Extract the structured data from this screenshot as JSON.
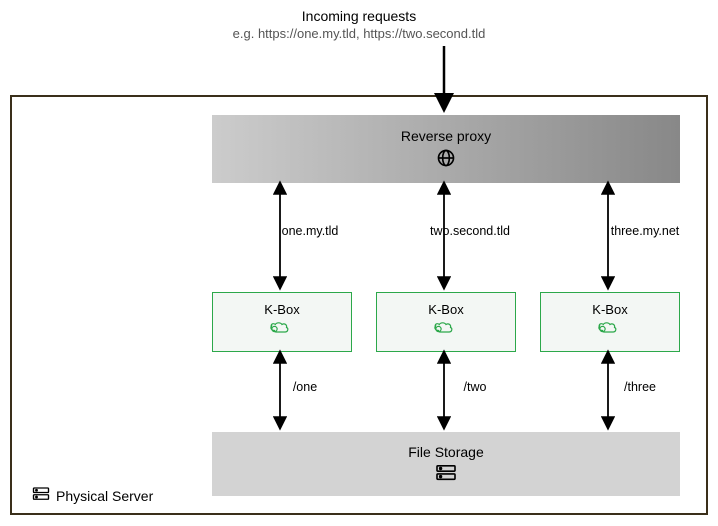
{
  "incoming": {
    "title": "Incoming requests",
    "subtitle": "e.g. https://one.my.tld, https://two.second.tld"
  },
  "server": {
    "label": "Physical Server"
  },
  "proxy": {
    "label": "Reverse proxy"
  },
  "domains": {
    "d1": "one.my.tld",
    "d2": "two.second.tld",
    "d3": "three.my.net"
  },
  "kbox": {
    "label": "K-Box"
  },
  "paths": {
    "p1": "/one",
    "p2": "/two",
    "p3": "/three"
  },
  "storage": {
    "label": "File Storage"
  },
  "colors": {
    "green": "#2ca84a",
    "border": "#3a2f1a"
  }
}
